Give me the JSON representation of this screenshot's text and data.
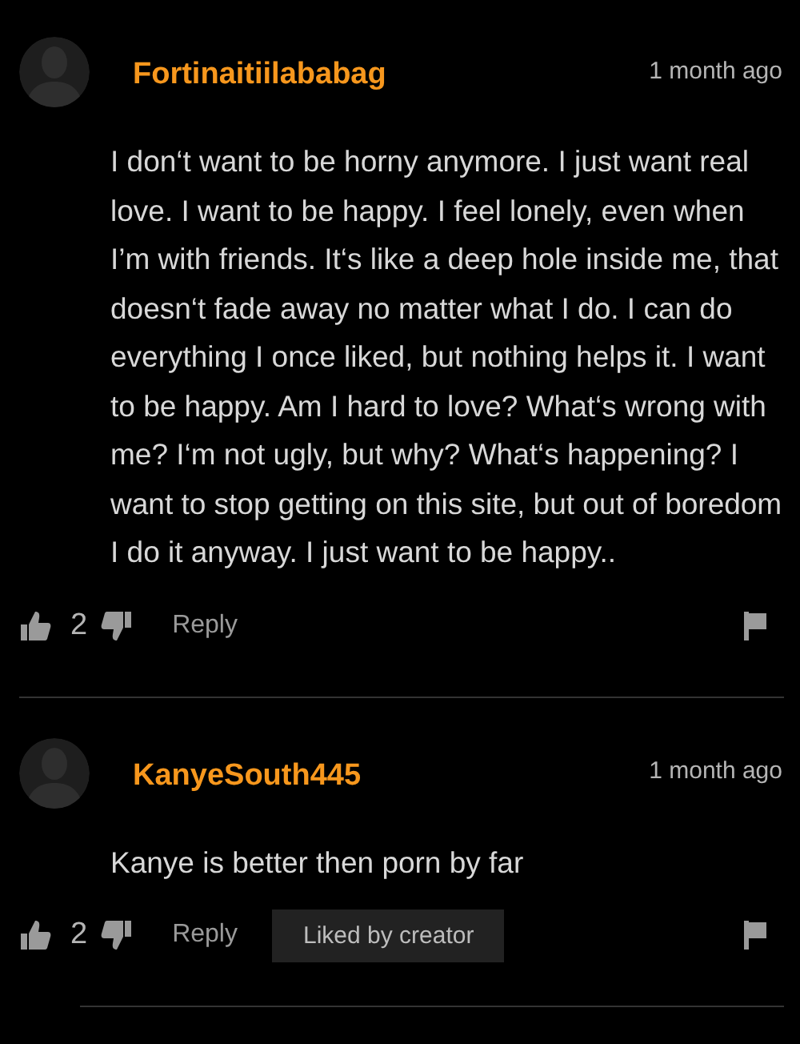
{
  "comments": [
    {
      "username": "Fortinaitiilababag",
      "time": "1 month ago",
      "text": "I don‘t want to be horny anymore. I just want real love. I want to be happy. I feel lonely, even when I’m with friends. It‘s like a deep hole inside me, that doesn‘t fade away no matter what I do. I can do everything I once liked, but nothing helps it. I want to be happy. Am I hard to love? What‘s wrong with me? I‘m not ugly, but why? What‘s happening? I want to stop getting on this site, but out of boredom I do it anyway. I just want to be happy..",
      "likes": "2",
      "reply": "Reply"
    },
    {
      "username": "KanyeSouth445",
      "time": "1 month ago",
      "text": "Kanye is better then porn by far",
      "likes": "2",
      "reply": "Reply",
      "badge": "Liked by creator"
    }
  ]
}
